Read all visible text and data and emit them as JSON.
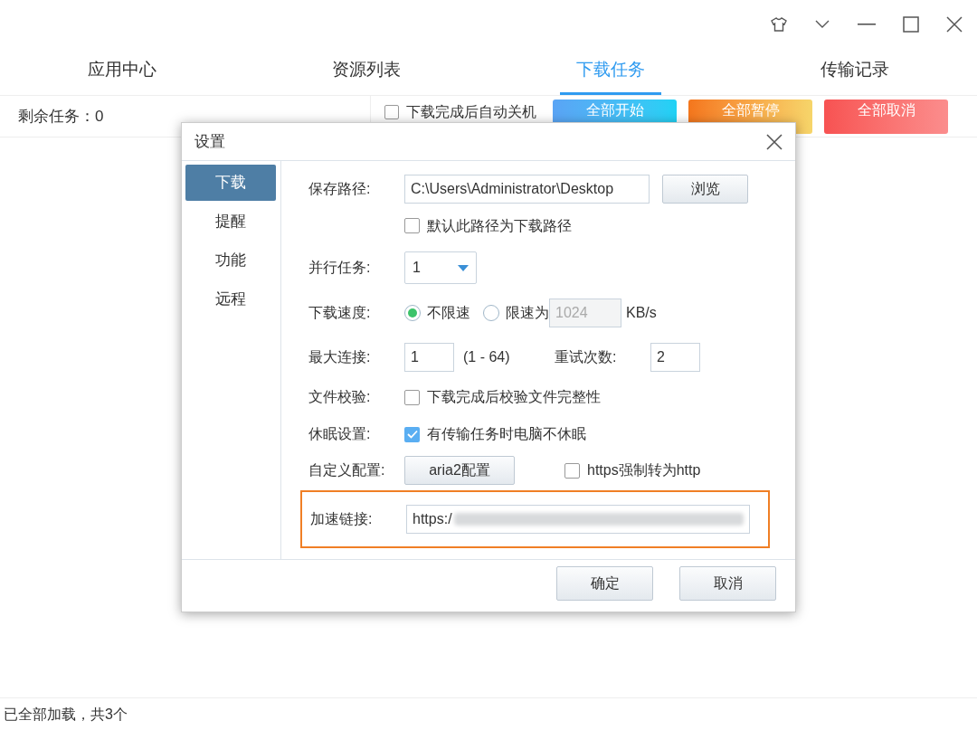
{
  "tabs": [
    {
      "label": "应用中心",
      "selected": false
    },
    {
      "label": "资源列表",
      "selected": false
    },
    {
      "label": "下载任务",
      "selected": true
    },
    {
      "label": "传输记录",
      "selected": false
    }
  ],
  "toolbar": {
    "remaining": "剩余任务：0",
    "auto_shutdown": {
      "label": "下载完成后自动关机",
      "checked": false
    },
    "buttons": [
      {
        "label": "全部开始",
        "kind": "start"
      },
      {
        "label": "全部暂停",
        "kind": "pause"
      },
      {
        "label": "全部取消",
        "kind": "cancel"
      }
    ]
  },
  "dialog": {
    "title": "设置",
    "sidebar": [
      {
        "label": "下载",
        "selected": true
      },
      {
        "label": "提醒",
        "selected": false
      },
      {
        "label": "功能",
        "selected": false
      },
      {
        "label": "远程",
        "selected": false
      }
    ],
    "save_path": {
      "label": "保存路径:",
      "value": "C:\\Users\\Administrator\\Desktop",
      "browse_button": "浏览",
      "default_checkbox": {
        "label": "默认此路径为下载路径",
        "checked": false
      }
    },
    "parallel_tasks": {
      "label": "并行任务:",
      "value": "1"
    },
    "download_speed": {
      "label": "下载速度:",
      "options": [
        {
          "label": "不限速",
          "selected": true
        },
        {
          "label": "限速为",
          "selected": false
        }
      ],
      "limit_value": "1024",
      "unit": "KB/s"
    },
    "max_connections": {
      "label": "最大连接:",
      "value": "1",
      "range": "(1 - 64)"
    },
    "retries": {
      "label": "重试次数:",
      "value": "2"
    },
    "file_verify": {
      "label": "文件校验:",
      "checkbox": {
        "label": "下载完成后校验文件完整性",
        "checked": false
      }
    },
    "sleep": {
      "label": "休眠设置:",
      "checkbox": {
        "label": "有传输任务时电脑不休眠",
        "checked": true
      }
    },
    "custom_config": {
      "label": "自定义配置:",
      "button": "aria2配置",
      "https_checkbox": {
        "label": "https强制转为http",
        "checked": false
      }
    },
    "accelerate_link": {
      "label": "加速链接:",
      "value": "https:/",
      "highlighted": true
    },
    "buttons": [
      "确定",
      "取消"
    ]
  },
  "status_bar": "已全部加载，共3个"
}
